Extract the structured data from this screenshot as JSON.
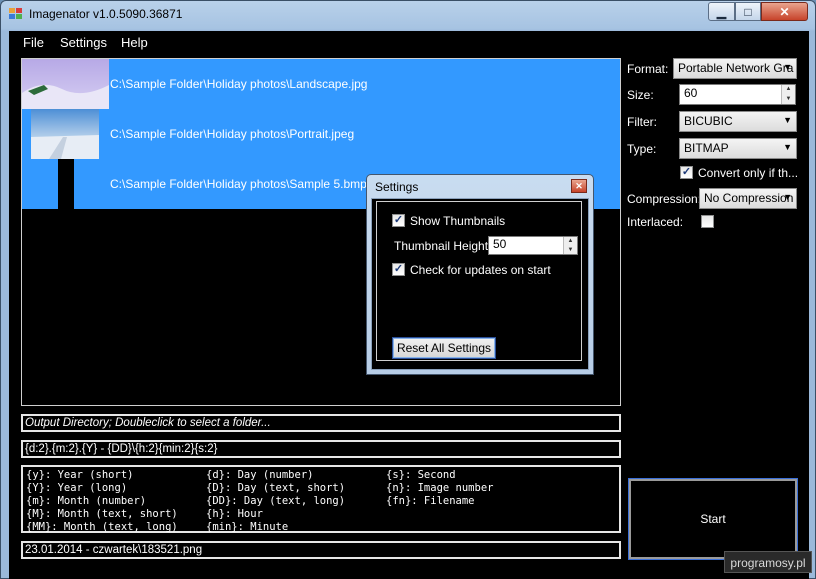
{
  "window": {
    "title": "Imagenator v1.0.5090.36871"
  },
  "caption_buttons": {
    "minimize": "▁",
    "maximize": "□",
    "close": "✕"
  },
  "menu": [
    "File",
    "Settings",
    "Help"
  ],
  "files": [
    {
      "path": "C:\\Sample Folder\\Holiday photos\\Landscape.jpg"
    },
    {
      "path": "C:\\Sample Folder\\Holiday photos\\Portrait.jpeg"
    },
    {
      "path": "C:\\Sample Folder\\Holiday photos\\Sample 5.bmp"
    }
  ],
  "output_directory": "Output Directory; Doubleclick to select a folder...",
  "pattern": "{d:2}.{m:2}.{Y} - {DD}\\{h:2}{min:2}{s:2}",
  "legend": {
    "col1": [
      "{y}: Year (short)",
      "{Y}: Year (long)",
      "{m}: Month (number)",
      "{M}: Month (text, short)",
      "{MM}: Month (text, long)"
    ],
    "col2": [
      "{d}: Day (number)",
      "{D}: Day (text, short)",
      "{DD}: Day (text, long)",
      "{h}: Hour",
      "{min}: Minute"
    ],
    "col3": [
      "{s}: Second",
      "{n}: Image number",
      "{fn}: Filename"
    ]
  },
  "preview": "23.01.2014 - czwartek\\183521.png",
  "options": {
    "format_label": "Format:",
    "format_value": "Portable Network Gra",
    "size_label": "Size:",
    "size_value": "60",
    "filter_label": "Filter:",
    "filter_value": "BICUBIC",
    "type_label": "Type:",
    "type_value": "BITMAP",
    "convert_label": "Convert only if th...",
    "convert_checked": true,
    "compression_label": "Compression:",
    "compression_value": "No Compression",
    "interlaced_label": "Interlaced:",
    "interlaced_checked": false
  },
  "start_label": "Start",
  "settings_dialog": {
    "title": "Settings",
    "show_thumbnails": "Show Thumbnails",
    "show_thumbnails_checked": true,
    "thumb_height_label": "Thumbnail Height:",
    "thumb_height_value": "50",
    "check_updates": "Check for updates on start",
    "check_updates_checked": true,
    "reset_label": "Reset All Settings"
  },
  "watermark": "programosy.pl",
  "colors": {
    "selection": "#3399ff",
    "background": "#000000"
  }
}
